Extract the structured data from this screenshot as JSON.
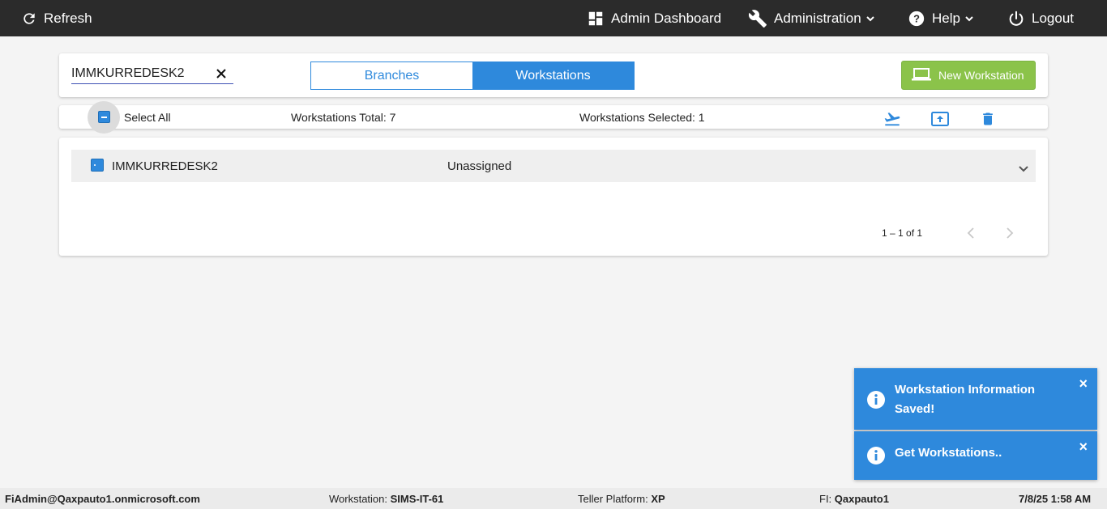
{
  "topbar": {
    "refresh_label": "Refresh",
    "admin_dashboard_label": "Admin Dashboard",
    "administration_label": "Administration",
    "help_label": "Help",
    "logout_label": "Logout"
  },
  "search": {
    "value": "IMMKURREDESK2"
  },
  "tabs": [
    {
      "label": "Branches",
      "active": false
    },
    {
      "label": "Workstations",
      "active": true
    }
  ],
  "new_workstation_label": "New Workstation",
  "toolbar": {
    "select_all_label": "Select All",
    "total_label": "Workstations Total: 7",
    "selected_label": "Workstations Selected: 1",
    "icons": [
      "departure-icon",
      "upload-icon",
      "trash-icon"
    ]
  },
  "rows": [
    {
      "name": "IMMKURREDESK2",
      "status": "Unassigned"
    }
  ],
  "pager": {
    "range_label": "1 – 1 of 1"
  },
  "toasts": [
    {
      "message": "Workstation Information Saved!",
      "close": "×"
    },
    {
      "message": "Get Workstations..",
      "close": "×"
    }
  ],
  "statusbar": {
    "user": "FiAdmin@Qaxpauto1.onmicrosoft.com",
    "workstation_label": "Workstation:",
    "workstation_value": "SIMS-IT-61",
    "platform_label": "Teller Platform:",
    "platform_value": "XP",
    "fi_label": "FI:",
    "fi_value": "Qaxpauto1",
    "datetime": "7/8/25 1:58 AM"
  },
  "colors": {
    "topbar": "#2b2b2b",
    "accent_blue": "#2e89dc",
    "new_button_green": "#8bc34a",
    "toast_blue": "#2e89dc"
  }
}
